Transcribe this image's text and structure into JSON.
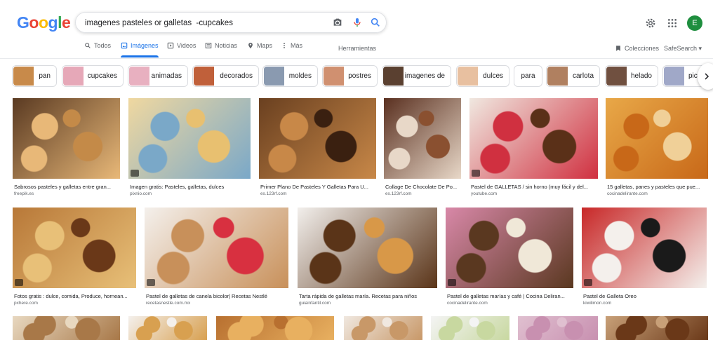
{
  "logo": {
    "letters": [
      "G",
      "o",
      "o",
      "g",
      "l",
      "e"
    ]
  },
  "search": {
    "value": "imagenes pasteles or galletas  -cupcakes"
  },
  "avatar_letter": "E",
  "tabs": [
    {
      "label": "Todos",
      "icon": "search-icon"
    },
    {
      "label": "Imágenes",
      "icon": "image-icon",
      "active": true
    },
    {
      "label": "Videos",
      "icon": "video-icon"
    },
    {
      "label": "Noticias",
      "icon": "news-icon"
    },
    {
      "label": "Maps",
      "icon": "map-pin-icon"
    },
    {
      "label": "Más",
      "icon": "more-vertical-icon"
    }
  ],
  "tools_label": "Herramientas",
  "colecciones_label": "Colecciones",
  "safesearch_label": "SafeSearch ▾",
  "chips": [
    {
      "label": "pan",
      "color": "#c88a4a"
    },
    {
      "label": "cupcakes",
      "color": "#e6a8b8"
    },
    {
      "label": "animadas",
      "color": "#e8b0c0"
    },
    {
      "label": "decorados",
      "color": "#c0603a"
    },
    {
      "label": "moldes",
      "color": "#8a9ab0"
    },
    {
      "label": "postres",
      "color": "#d09070"
    },
    {
      "label": "imagenes de",
      "color": "#5a4030"
    },
    {
      "label": "dulces",
      "color": "#e8c0a0"
    },
    {
      "label": "para",
      "color": ""
    },
    {
      "label": "carlota",
      "color": "#b08060"
    },
    {
      "label": "helado",
      "color": "#705040"
    },
    {
      "label": "pica",
      "color": "#a0a8c8"
    }
  ],
  "results_row1": [
    {
      "title": "Sabrosos pasteles y galletas entre gran...",
      "source": "freepik.es",
      "colors": [
        "#5a3a22",
        "#e8b878",
        "#c48a48"
      ],
      "badge": false
    },
    {
      "title": "Imagen gratis: Pasteles, galletas, dulces",
      "source": "pixnio.com",
      "colors": [
        "#f0d8a0",
        "#7aa8c8",
        "#e8c070"
      ],
      "badge": true
    },
    {
      "title": "Primer Plano De Pasteles Y Galletas Para U...",
      "source": "es.123rf.com",
      "colors": [
        "#6a4020",
        "#c88848",
        "#3a2010"
      ],
      "badge": false
    },
    {
      "title": "Collage De Chocolate De Po...",
      "source": "es.123rf.com",
      "colors": [
        "#5a3020",
        "#e8d8c8",
        "#8a5030"
      ],
      "badge": false
    },
    {
      "title": "Pastel de GALLETAS / sin horno (muy fácil y del...",
      "source": "youtube.com",
      "colors": [
        "#f0e8e0",
        "#d03040",
        "#5a3018"
      ],
      "badge": true
    },
    {
      "title": "15 galletas, panes y pasteles que pue...",
      "source": "cocinadelirante.com",
      "colors": [
        "#e8a848",
        "#c86818",
        "#f0d098"
      ],
      "badge": false
    }
  ],
  "results_row2": [
    {
      "title": "Fotos gratis : dulce, comida, Produce, hornean...",
      "source": "pxhere.com",
      "colors": [
        "#b87838",
        "#e8c078",
        "#6a3818"
      ],
      "badge": true
    },
    {
      "title": "Pastel de galletas de canela bicolor| Recetas Nestlé",
      "source": "recetasnestle.com.mx",
      "colors": [
        "#f4f0ec",
        "#c8905a",
        "#d83040"
      ],
      "badge": true
    },
    {
      "title": "Tarta rápida de galletas maría. Recetas para niños",
      "source": "guiainfantil.com",
      "colors": [
        "#f2efec",
        "#5a3418",
        "#d89848"
      ],
      "badge": false
    },
    {
      "title": "Pastel de galletas marías y café | Cocina Deliran...",
      "source": "cocinadelirante.com",
      "colors": [
        "#d888a8",
        "#5a3820",
        "#f0e8d8"
      ],
      "badge": true
    },
    {
      "title": "Pastel de Galleta Oreo",
      "source": "kiwilimon.com",
      "colors": [
        "#c82828",
        "#f4f0ec",
        "#1a1a1a"
      ],
      "badge": true
    }
  ],
  "results_row3": [
    {
      "colors": [
        "#e8d8c0",
        "#a87848"
      ]
    },
    {
      "colors": [
        "#f4f0ec",
        "#d8a050"
      ]
    },
    {
      "colors": [
        "#b87030",
        "#e8b060"
      ]
    },
    {
      "colors": [
        "#f0e8e0",
        "#c89868"
      ]
    },
    {
      "colors": [
        "#f4f4f4",
        "#c8d8a0"
      ]
    },
    {
      "colors": [
        "#e0c0d0",
        "#c890b0"
      ]
    },
    {
      "colors": [
        "#c8a078",
        "#6a3818"
      ]
    }
  ]
}
